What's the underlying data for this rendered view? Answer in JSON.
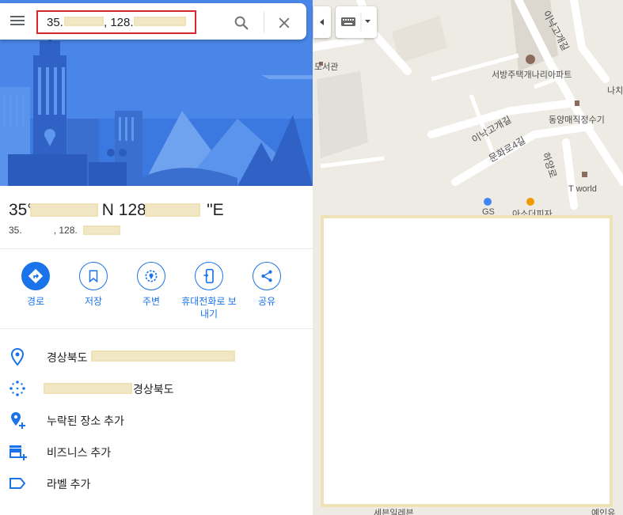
{
  "search": {
    "value_prefix_1": "35.",
    "value_prefix_2": ", 128."
  },
  "place": {
    "title_part1": "35°",
    "title_part2": "N 128°",
    "title_part3": "\"E",
    "subtitle_part1": "35.",
    "subtitle_part2": ", 128."
  },
  "actions": [
    {
      "label": "경로",
      "icon": "directions-icon"
    },
    {
      "label": "저장",
      "icon": "bookmark-icon"
    },
    {
      "label": "주변",
      "icon": "nearby-icon"
    },
    {
      "label": "휴대전화로 보내기",
      "icon": "phone-send-icon"
    },
    {
      "label": "공유",
      "icon": "share-icon"
    }
  ],
  "info_rows": [
    {
      "text": "경상북도",
      "icon": "location-pin-icon"
    },
    {
      "text": "경상북도",
      "icon": "plus-code-icon"
    },
    {
      "text": "누락된 장소 추가",
      "icon": "add-place-icon"
    },
    {
      "text": "비즈니스 추가",
      "icon": "add-business-icon"
    },
    {
      "text": "라벨 추가",
      "icon": "label-icon"
    }
  ],
  "map": {
    "labels": {
      "library": "도서관",
      "apartment": "서방주택개나리아파트",
      "market": "동양매직정수기",
      "tworld": "T world",
      "road1": "이낙고개길",
      "road2": "문화로4길",
      "road3": "하양로",
      "road4": "이낙고개길",
      "shop": "아소더피자",
      "nj": "나치",
      "bottom": "세븐일레븐",
      "bottom2": "예인유",
      "gs": "GS"
    }
  },
  "colors": {
    "accent": "#1a73e8",
    "hero_bg": "#4a86e8",
    "search_highlight": "#d9262c",
    "redaction": "#f1e7c5"
  }
}
